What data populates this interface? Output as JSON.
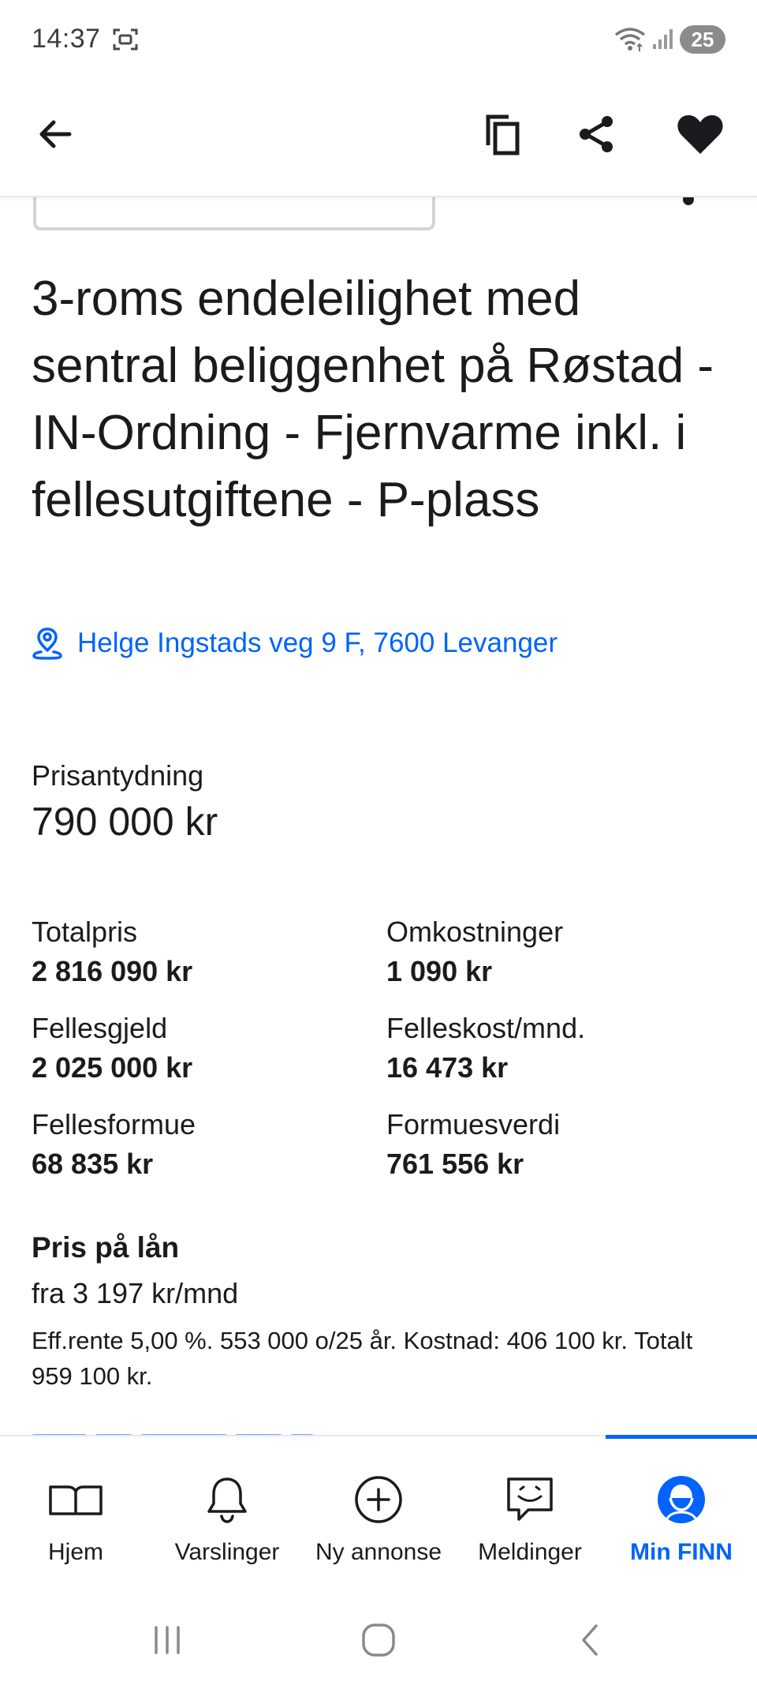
{
  "status_bar": {
    "time": "14:37",
    "battery": "25"
  },
  "listing": {
    "title": "3-roms endeleilighet med sentral beliggenhet på Røstad - IN-Ordning - Fjernvarme inkl. i fellesutgiftene - P-plass",
    "address": "Helge Ingstads veg 9 F, 7600 Levanger"
  },
  "price": {
    "label": "Prisantydning",
    "value": "790 000 kr"
  },
  "facts": [
    {
      "label": "Totalpris",
      "value": "2 816 090 kr"
    },
    {
      "label": "Omkostninger",
      "value": "1 090 kr"
    },
    {
      "label": "Fellesgjeld",
      "value": "2 025 000 kr"
    },
    {
      "label": "Felleskost/mnd.",
      "value": "16 473 kr"
    },
    {
      "label": "Fellesformue",
      "value": "68 835 kr"
    },
    {
      "label": "Formuesverdi",
      "value": "761 556 kr"
    }
  ],
  "loan": {
    "title": "Pris på lån",
    "from": "fra 3 197 kr/mnd",
    "detail": "Eff.rente 5,00 %. 553 000 o/25 år. Kostnad: 406 100 kr. Totalt 959 100 kr."
  },
  "bottom_nav": {
    "items": [
      {
        "label": "Hjem",
        "icon": "book-icon"
      },
      {
        "label": "Varslinger",
        "icon": "bell-icon"
      },
      {
        "label": "Ny annonse",
        "icon": "plus-circle-icon"
      },
      {
        "label": "Meldinger",
        "icon": "chat-icon"
      },
      {
        "label": "Min FINN",
        "icon": "profile-icon"
      }
    ],
    "active_index": 4
  },
  "colors": {
    "accent": "#0063fb",
    "text": "#1b1b1f"
  }
}
